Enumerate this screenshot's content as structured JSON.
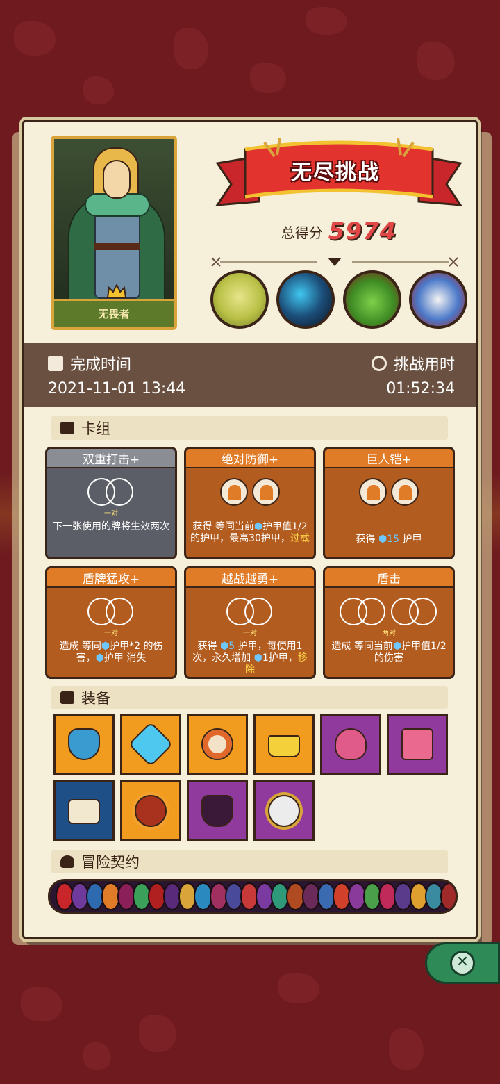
{
  "hero": {
    "name": "无畏者"
  },
  "banner": {
    "title": "无尽挑战"
  },
  "score": {
    "label": "总得分",
    "value": "5974"
  },
  "bosses": [
    {
      "icon": "bone-dragon-boss-icon"
    },
    {
      "icon": "shadow-beast-boss-icon"
    },
    {
      "icon": "goblin-king-boss-icon"
    },
    {
      "icon": "armored-skull-boss-icon"
    }
  ],
  "time": {
    "complete_label": "完成时间",
    "complete_value": "2021-11-01 13:44",
    "duration_label": "挑战用时",
    "duration_value": "01:52:34"
  },
  "sections": {
    "deck": "卡组",
    "equipment": "装备",
    "contracts": "冒险契约"
  },
  "cards": [
    {
      "title": "双重打击+",
      "style": "gray",
      "sub": "一对",
      "desc": "下一张使用的牌将生效两次"
    },
    {
      "title": "绝对防御+",
      "style": "orange",
      "sub": "",
      "desc_parts": [
        "获得 等同当前",
        "护甲值1/2的护甲，最高30护甲，",
        "过载"
      ]
    },
    {
      "title": "巨人铠+",
      "style": "orange",
      "sub": "",
      "desc_parts": [
        "获得 ",
        "15",
        " 护甲"
      ]
    },
    {
      "title": "盾牌猛攻+",
      "style": "orange",
      "sub": "一对",
      "desc_parts": [
        "造成 等同",
        "护甲*2 的伤害，",
        "护甲 消失"
      ]
    },
    {
      "title": "越战越勇+",
      "style": "orange",
      "sub": "一对",
      "desc_parts": [
        "获得 ",
        "5",
        " 护甲，每使用1次，永久增加 ",
        "1护甲，",
        "移除"
      ]
    },
    {
      "title": "盾击",
      "style": "orange",
      "sub": "两对",
      "desc_parts": [
        "造成 等同当前",
        "护甲值1/2的伤害"
      ]
    }
  ],
  "equipment": [
    {
      "color": "orange",
      "icon": "spiked-mask-icon"
    },
    {
      "color": "orange",
      "icon": "blue-crystal-shield-icon"
    },
    {
      "color": "orange",
      "icon": "round-shield-icon"
    },
    {
      "color": "orange",
      "icon": "golden-crown-icon"
    },
    {
      "color": "purple",
      "icon": "spotted-mushroom-icon"
    },
    {
      "color": "purple",
      "icon": "melting-cake-icon"
    },
    {
      "color": "blue",
      "icon": "scroll-icon"
    },
    {
      "color": "orange",
      "icon": "flame-ring-icon"
    },
    {
      "color": "purple",
      "icon": "jeweled-armor-icon"
    },
    {
      "color": "purple",
      "icon": "mirror-icon"
    }
  ],
  "colors": {
    "panel": "#f6efd9",
    "background": "#6e1a1f",
    "score": "#e04848",
    "card_orange": "#b35c1f",
    "card_gray": "#5b5e66"
  }
}
